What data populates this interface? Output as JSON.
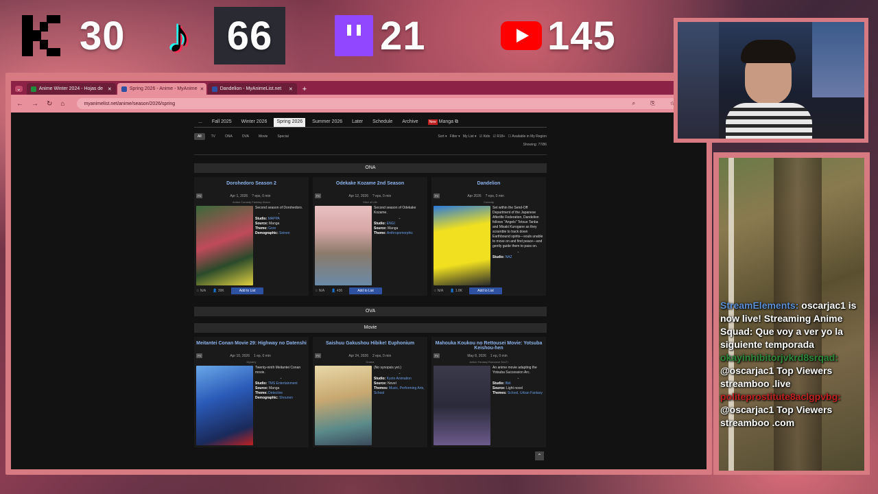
{
  "overlay": {
    "stats": [
      {
        "platform": "kick",
        "value": "30"
      },
      {
        "platform": "tiktok",
        "value": "66"
      },
      {
        "platform": "twitch",
        "value": "21"
      },
      {
        "platform": "youtube",
        "value": "145"
      }
    ]
  },
  "browser": {
    "tabs": [
      {
        "label": "Anime Winter 2024 - Hojas de",
        "color": "#1e8e3e"
      },
      {
        "label": "Spring 2026 - Anime - MyAnime",
        "color": "#2e51a2"
      },
      {
        "label": "Dandelion - MyAnimeList.net",
        "color": "#2e51a2"
      }
    ],
    "url": "myanimelist.net/anime/season/2026/spring"
  },
  "mal": {
    "season_nav": [
      "...",
      "Fall 2025",
      "Winter 2026",
      "Spring 2026",
      "Summer 2026",
      "Later",
      "Schedule",
      "Archive"
    ],
    "manga_badge": "New",
    "manga_label": "Manga",
    "type_filters": [
      "All",
      "TV",
      "ONA",
      "OVA",
      "Movie",
      "Special"
    ],
    "right_filters": "Sort ▾   Filter ▾   My List ▾   ☑ Kids   ☑ R18+   ☐ Available in My Region",
    "showing": "Showing: 77/86",
    "sections": {
      "ona": "ONA",
      "ova": "OVA",
      "movie": "Movie"
    },
    "ona_cards": [
      {
        "title": "Dorohedoro Season 2",
        "date": "Apr 1, 2026",
        "eps": "? eps, 0 min",
        "genres": "Action  Comedy  Fantasy  Horror",
        "synopsis": "Second season of Dorohedoro.",
        "studio": "MAPPA",
        "source": "Manga",
        "theme_label": "Theme:",
        "theme": "Gore",
        "extra_label": "Demographic:",
        "extra": "Seinen",
        "score": "N/A",
        "members": "39K",
        "add": "Add to List",
        "poster_a": "#3a6a3a",
        "poster_b": "#c04a5a"
      },
      {
        "title": "Odekake Kozame 2nd Season",
        "date": "Apr 12, 2026",
        "eps": "? eps, 0 min",
        "genres": "Slice of Life",
        "synopsis": "Second season of Odekake Kozame.",
        "studio": "ENGI",
        "source": "Manga",
        "theme_label": "Theme:",
        "theme": "Anthropomorphic",
        "extra_label": "",
        "extra": "",
        "score": "N/A",
        "members": "436",
        "add": "Add to List",
        "poster_a": "#d8a8a8",
        "poster_b": "#6a8aa8"
      },
      {
        "title": "Dandelion",
        "date": "Apr 2026",
        "eps": "? eps, 0 min",
        "genres": "Comedy",
        "synopsis": "Set within the Send-Off Department of the Japanese Afterlife Federation, Dandelion follows \"Angels\" Tetsuo Tanba and Misaki Kurogane as they scramble to track down Earthbound spirits—souls unable to move on and find peace—and gently guide them to pass on.",
        "studio": "NAZ",
        "source": "",
        "theme_label": "",
        "theme": "",
        "extra_label": "",
        "extra": "",
        "score": "N/A",
        "members": "1.8K",
        "add": "Add to List",
        "poster_a": "#f0e020",
        "poster_b": "#2a7ad8"
      }
    ],
    "movie_cards": [
      {
        "title": "Meitantei Conan Movie 29: Highway no Datenshi",
        "date": "Apr 10, 2026",
        "eps": "1 ep, 0 min",
        "genres": "Mystery",
        "synopsis": "Twenty-ninth Meitantei Conan movie.",
        "studio": "TMS Entertainment",
        "source": "Manga",
        "theme_label": "Theme:",
        "theme": "Detective",
        "extra_label": "Demographic:",
        "extra": "Shounen",
        "poster_a": "#2a5ab8",
        "poster_b": "#1a2a5a"
      },
      {
        "title": "Saishuu Gakushou Hibike! Euphonium",
        "date": "Apr 24, 2026",
        "eps": "2 eps, 0 min",
        "genres": "Drama",
        "synopsis": "(No synopsis yet.)",
        "studio": "Kyoto Animation",
        "source": "Novel",
        "theme_label": "Themes:",
        "theme": "Music, Performing Arts, School",
        "extra_label": "",
        "extra": "",
        "poster_a": "#c8a870",
        "poster_b": "#5a8a8a"
      },
      {
        "title": "Mahouka Koukou no Rettousei Movie: Yotsuba Keishou-hen",
        "date": "May 8, 2026",
        "eps": "1 ep, 0 min",
        "genres": "Action  Fantasy  Romance  Sci-Fi",
        "synopsis": "An anime movie adapting the Yotsuba Succession Arc.",
        "studio": "8bit",
        "source": "Light novel",
        "theme_label": "Themes:",
        "theme": "School, Urban Fantasy",
        "extra_label": "",
        "extra": "",
        "poster_a": "#2a2a3a",
        "poster_b": "#6a5a8a"
      }
    ],
    "icons": {
      "back_to_top": "chevron-up-icon"
    }
  },
  "chat": {
    "messages": [
      {
        "user": "StreamElements:",
        "text": "oscarjac1 is now live! Streaming Anime Squad: Que voy a ver yo la siguiente temporada",
        "color": "#5b8fd6"
      },
      {
        "user": "okayinhibitorjvkrd8srqad:",
        "text": "@oscarjac1 Top Viewers streamboo .live",
        "color": "#2d8a3a"
      },
      {
        "user": "politeprostitute8aclgpvbg:",
        "text": "@oscarjac1 Top Viewers streamboo .com",
        "color": "#c02020"
      }
    ]
  }
}
